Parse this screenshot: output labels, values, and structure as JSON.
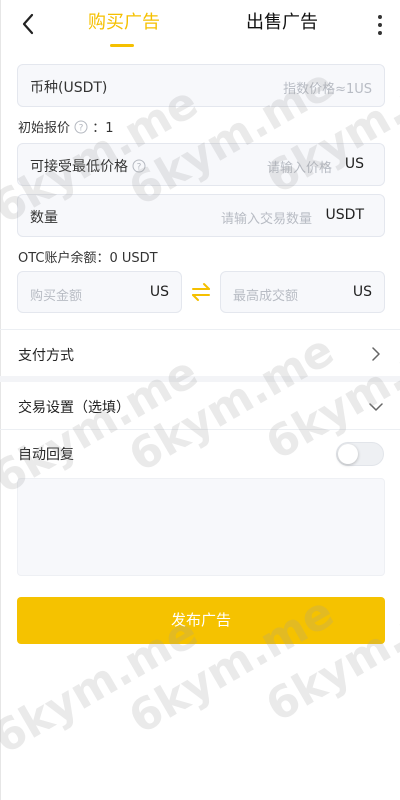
{
  "header": {
    "tab_buy": "购买广告",
    "tab_sell": "出售广告",
    "accent_color": "#f5c000"
  },
  "form": {
    "currency_label": "币种(USDT)",
    "currency_placeholder": "指数价格≈1US",
    "initial_price_label": "初始报价",
    "initial_price_value": "：1",
    "min_price_label": "可接受最低价格",
    "min_price_placeholder": "请输入价格",
    "min_price_unit": "US",
    "quantity_label": "数量",
    "quantity_placeholder": "请输入交易数量",
    "quantity_unit": "USDT",
    "otc_balance": "OTC账户余额：0 USDT",
    "buy_amount_placeholder": "购买金额",
    "buy_amount_unit": "US",
    "max_amount_placeholder": "最高成交额",
    "max_amount_unit": "US"
  },
  "payment": {
    "label": "支付方式"
  },
  "trade_settings": {
    "label": "交易设置（选填）"
  },
  "auto_reply": {
    "label": "自动回复",
    "enabled": false
  },
  "submit": {
    "label": "发布广告",
    "color": "#f5c200"
  },
  "watermark": {
    "text": "6kym.me"
  }
}
